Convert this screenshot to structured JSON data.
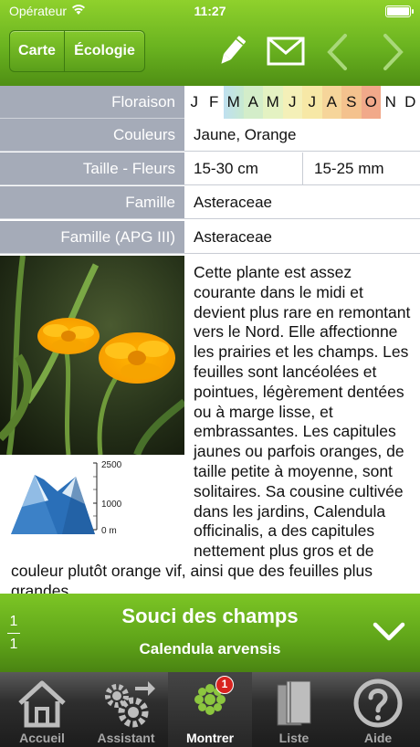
{
  "status": {
    "carrier": "Opérateur",
    "time": "11:27"
  },
  "toolbar": {
    "tab_map": "Carte",
    "tab_ecology": "Écologie"
  },
  "fields": {
    "flowering_label": "Floraison",
    "months": [
      "J",
      "F",
      "M",
      "A",
      "M",
      "J",
      "J",
      "A",
      "S",
      "O",
      "N",
      "D"
    ],
    "colors_label": "Couleurs",
    "colors_value": "Jaune, Orange",
    "size_label": "Taille - Fleurs",
    "size_value": "15-30 cm",
    "flower_size_value": "15-25 mm",
    "family_label": "Famille",
    "family_value": "Asteraceae",
    "apg_label": "Famille (APG III)",
    "apg_value": "Asteraceae"
  },
  "altitude": {
    "ticks": [
      "2500",
      "1000",
      "0 m"
    ]
  },
  "description": "Cette plante est assez courante dans le midi et devient plus rare en remontant vers le Nord. Elle affectionne les prairies et les champs. Les feuilles sont lancéolées et pointues, légèrement dentées ou à marge lisse, et embrassantes. Les capitules jaunes ou parfois oranges, de taille petite à moyenne, sont solitaires. Sa cousine cultivée dans les jardins, Calendula officinalis, a des capitules nettement plus gros et de couleur plutôt orange vif, ainsi que des feuilles plus grandes.",
  "species": {
    "index": "1",
    "total": "1",
    "name": "Souci des champs",
    "latin": "Calendula arvensis"
  },
  "tabs": [
    {
      "label": "Accueil",
      "icon": "house-icon"
    },
    {
      "label": "Assistant",
      "icon": "gears-icon"
    },
    {
      "label": "Montrer",
      "icon": "flower-icon",
      "badge": "1"
    },
    {
      "label": "Liste",
      "icon": "books-icon"
    },
    {
      "label": "Aide",
      "icon": "help-icon"
    }
  ]
}
